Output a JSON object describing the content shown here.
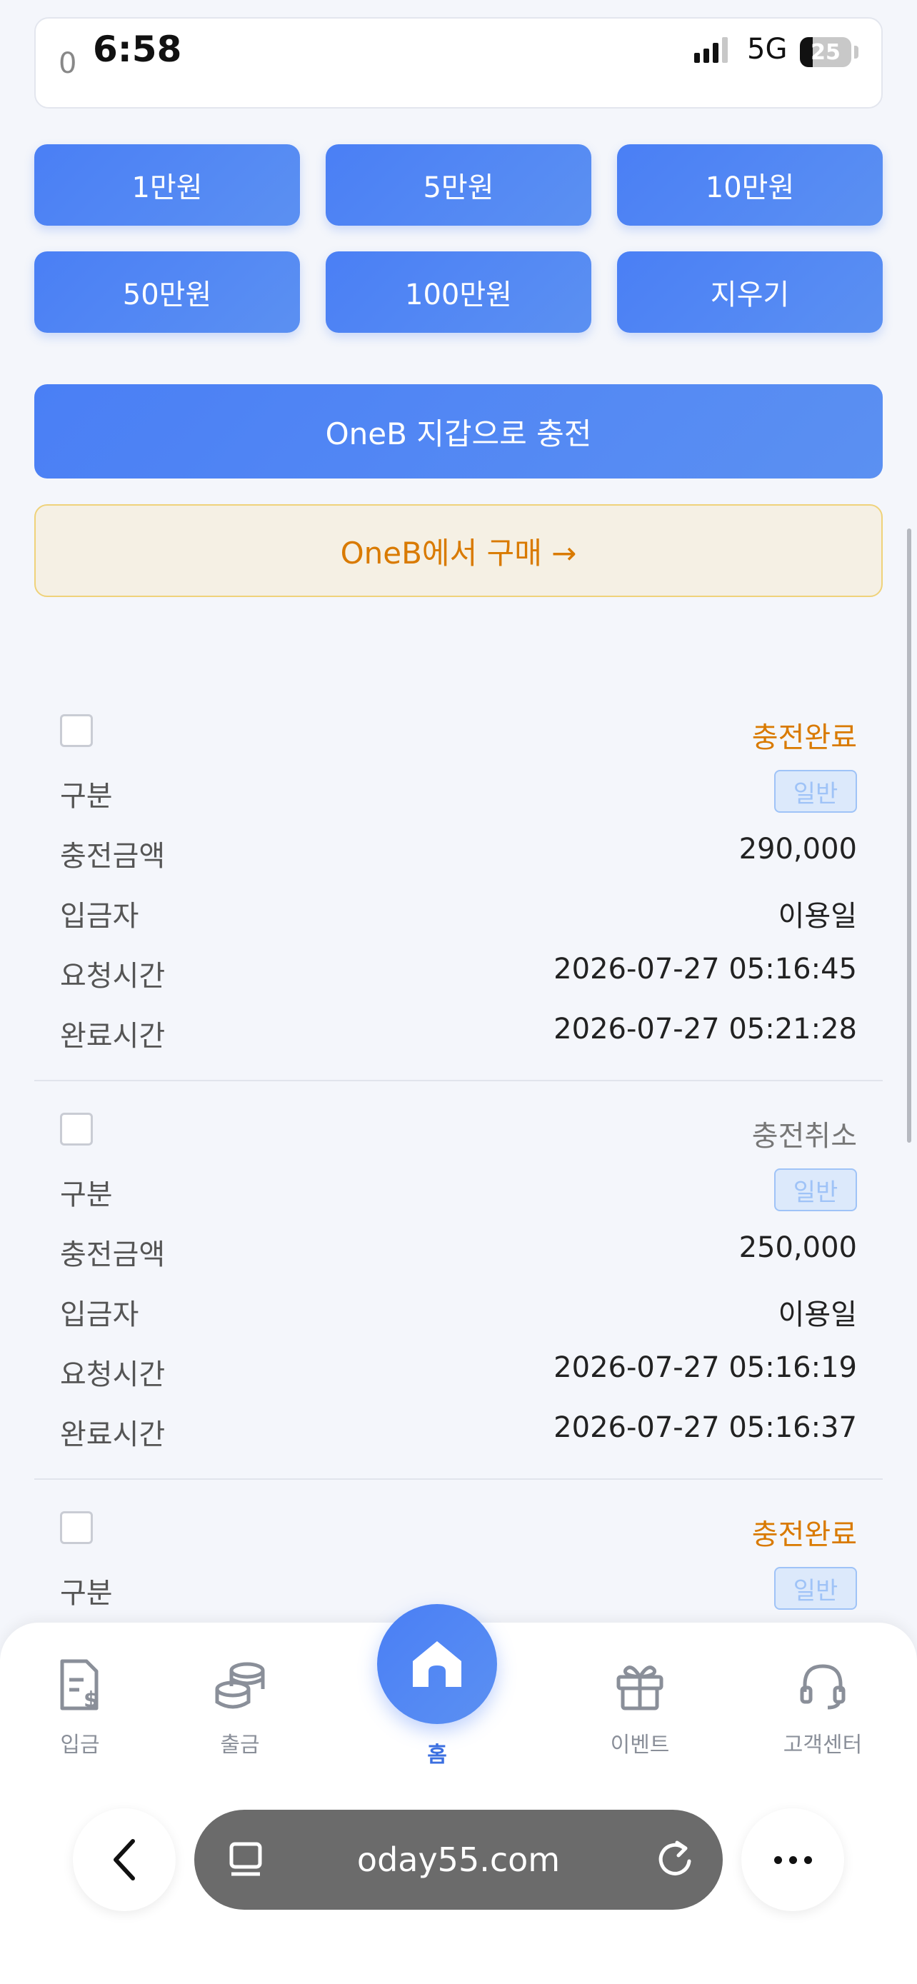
{
  "status_bar": {
    "time": "6:58",
    "network": "5G",
    "battery": "25"
  },
  "amount_input": {
    "value": "0"
  },
  "quick_amounts": [
    "1만원",
    "5만원",
    "10만원",
    "50만원",
    "100만원",
    "지우기"
  ],
  "charge_button": "OneB 지갑으로 충전",
  "buy_button": "OneB에서 구매 →",
  "labels": {
    "type": "구분",
    "amount": "충전금액",
    "depositor": "입금자",
    "request_time": "요청시간",
    "complete_time": "완료시간"
  },
  "records": [
    {
      "status": "충전완료",
      "type": "일반",
      "amount": "290,000",
      "depositor": "이용일",
      "request_time": "2026-07-27 05:16:45",
      "complete_time": "2026-07-27 05:21:28"
    },
    {
      "status": "충전취소",
      "type": "일반",
      "amount": "250,000",
      "depositor": "이용일",
      "request_time": "2026-07-27 05:16:19",
      "complete_time": "2026-07-27 05:16:37"
    },
    {
      "status": "충전완료",
      "type": "일반"
    }
  ],
  "nav": {
    "deposit": "입금",
    "withdraw": "출금",
    "home": "홈",
    "event": "이벤트",
    "support": "고객센터"
  },
  "browser": {
    "url": "oday55.com"
  },
  "colors": {
    "primary": "#4a7ff5",
    "accent": "#d97a00",
    "badge": "#9fc3f7"
  }
}
